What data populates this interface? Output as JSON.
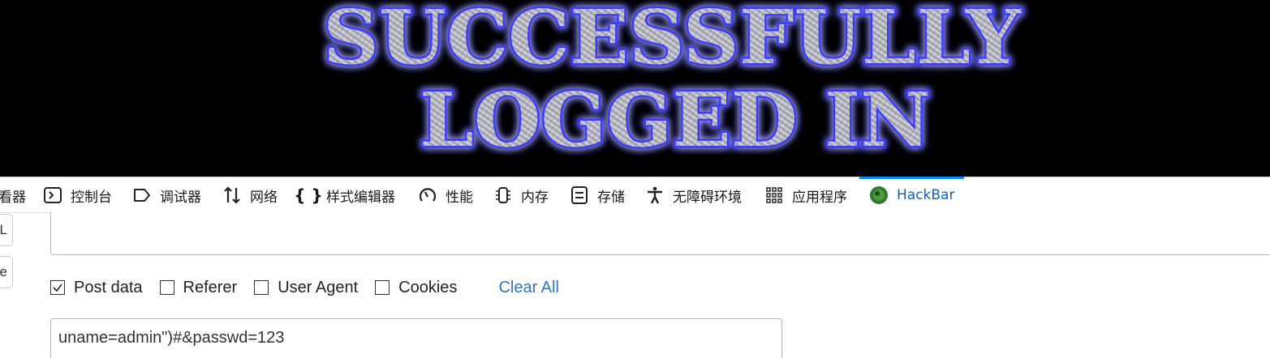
{
  "banner": {
    "line1": "SUCCESSFULLY",
    "line2": "LOGGED IN",
    "glow_color": "#2a2aff",
    "text_color": "#b9b9c4"
  },
  "tabs": [
    {
      "label": "查看器",
      "icon": "inspector-icon",
      "visible_text": "看器"
    },
    {
      "label": "控制台",
      "icon": "console-icon"
    },
    {
      "label": "调试器",
      "icon": "debugger-icon"
    },
    {
      "label": "网络",
      "icon": "network-arrows-icon"
    },
    {
      "label": "样式编辑器",
      "icon": "braces-icon"
    },
    {
      "label": "性能",
      "icon": "gauge-icon"
    },
    {
      "label": "内存",
      "icon": "memory-chip-icon"
    },
    {
      "label": "存储",
      "icon": "storage-icon"
    },
    {
      "label": "无障碍环境",
      "icon": "accessibility-icon"
    },
    {
      "label": "应用程序",
      "icon": "app-grid-icon"
    },
    {
      "label": "HackBar",
      "icon": "hackbar-icon",
      "active": true
    }
  ],
  "sidebar": {
    "url_button": "URL",
    "execute_button": "te"
  },
  "options": {
    "post_data": {
      "label": "Post data",
      "checked": true
    },
    "referer": {
      "label": "Referer",
      "checked": false
    },
    "user_agent": {
      "label": "User Agent",
      "checked": false
    },
    "cookies": {
      "label": "Cookies",
      "checked": false
    },
    "clear_all": "Clear All"
  },
  "post_body": "uname=admin\")#&passwd=123",
  "url_value": "",
  "accent_color": "#0a84ff",
  "link_color": "#2e75c2"
}
